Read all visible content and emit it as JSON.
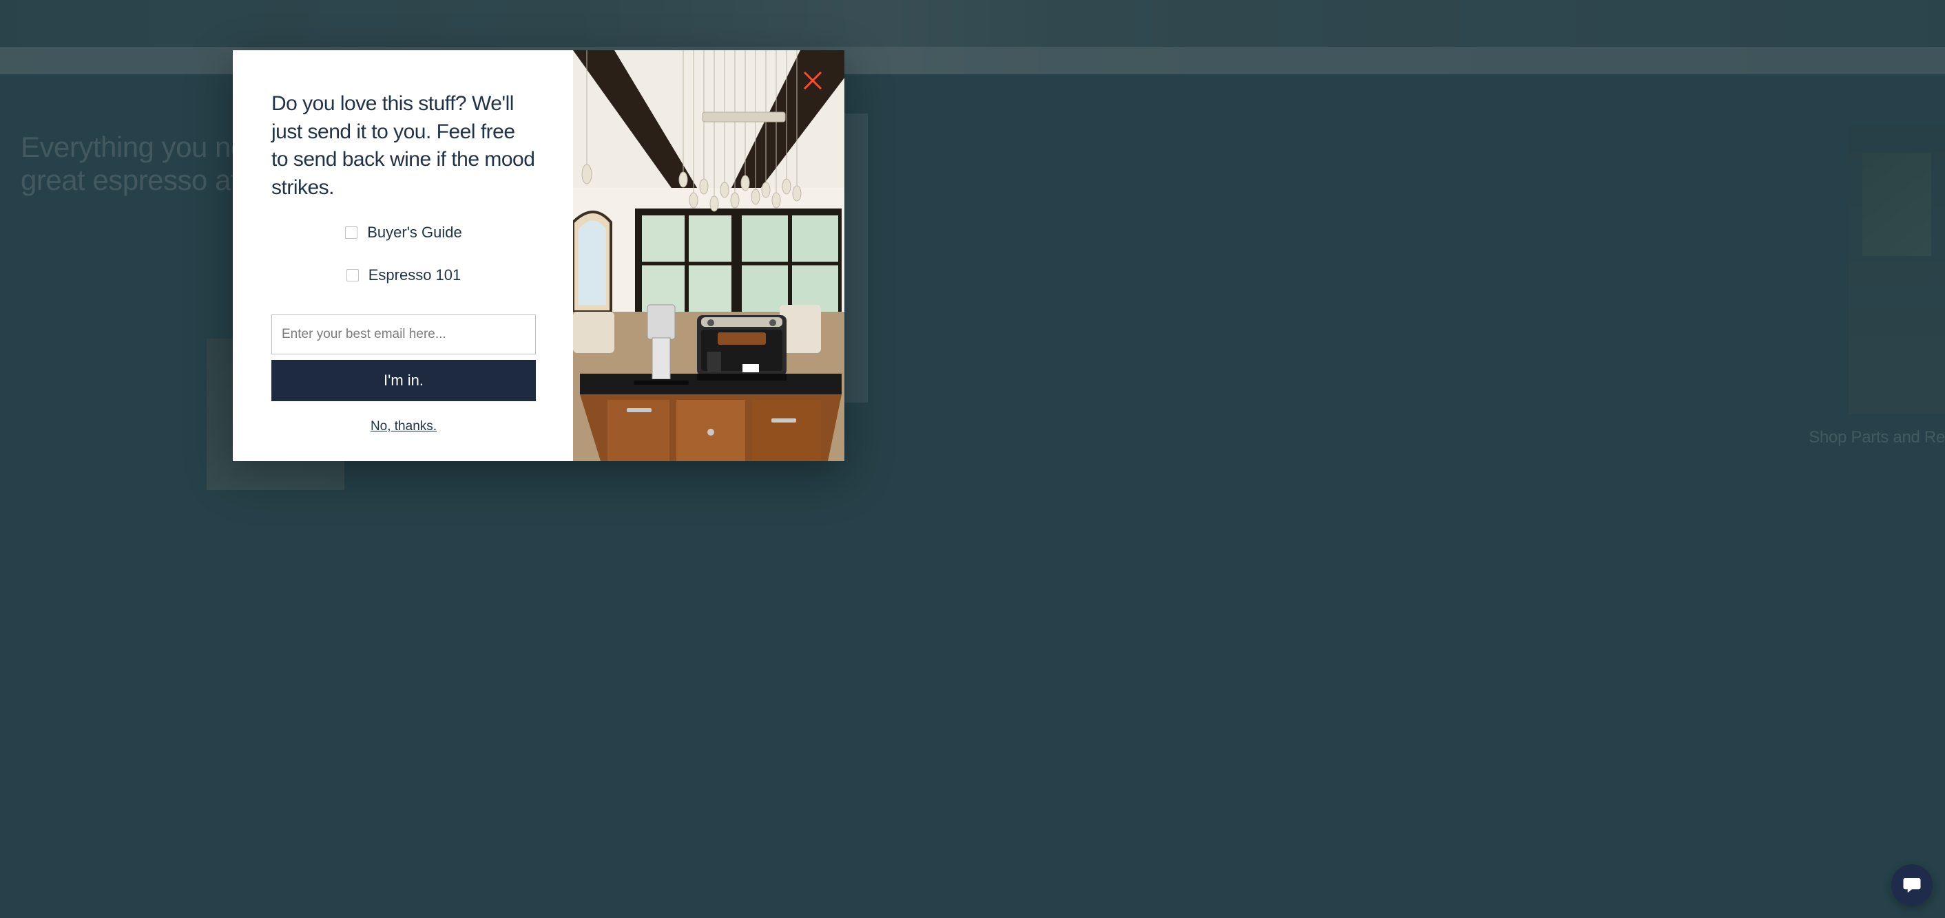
{
  "background": {
    "headline_line1": "Everything you need for",
    "headline_line2": "great espresso at home.",
    "right_card_label": "Shop Parts and Re"
  },
  "modal": {
    "heading": "Do you love this stuff? We'll just send it to you. Feel free to send back wine if the mood strikes.",
    "checkboxes": [
      {
        "label": "Buyer's Guide"
      },
      {
        "label": "Espresso 101"
      }
    ],
    "email_placeholder": "Enter your best email here...",
    "submit_label": "I'm in.",
    "decline_label": "No, thanks."
  }
}
